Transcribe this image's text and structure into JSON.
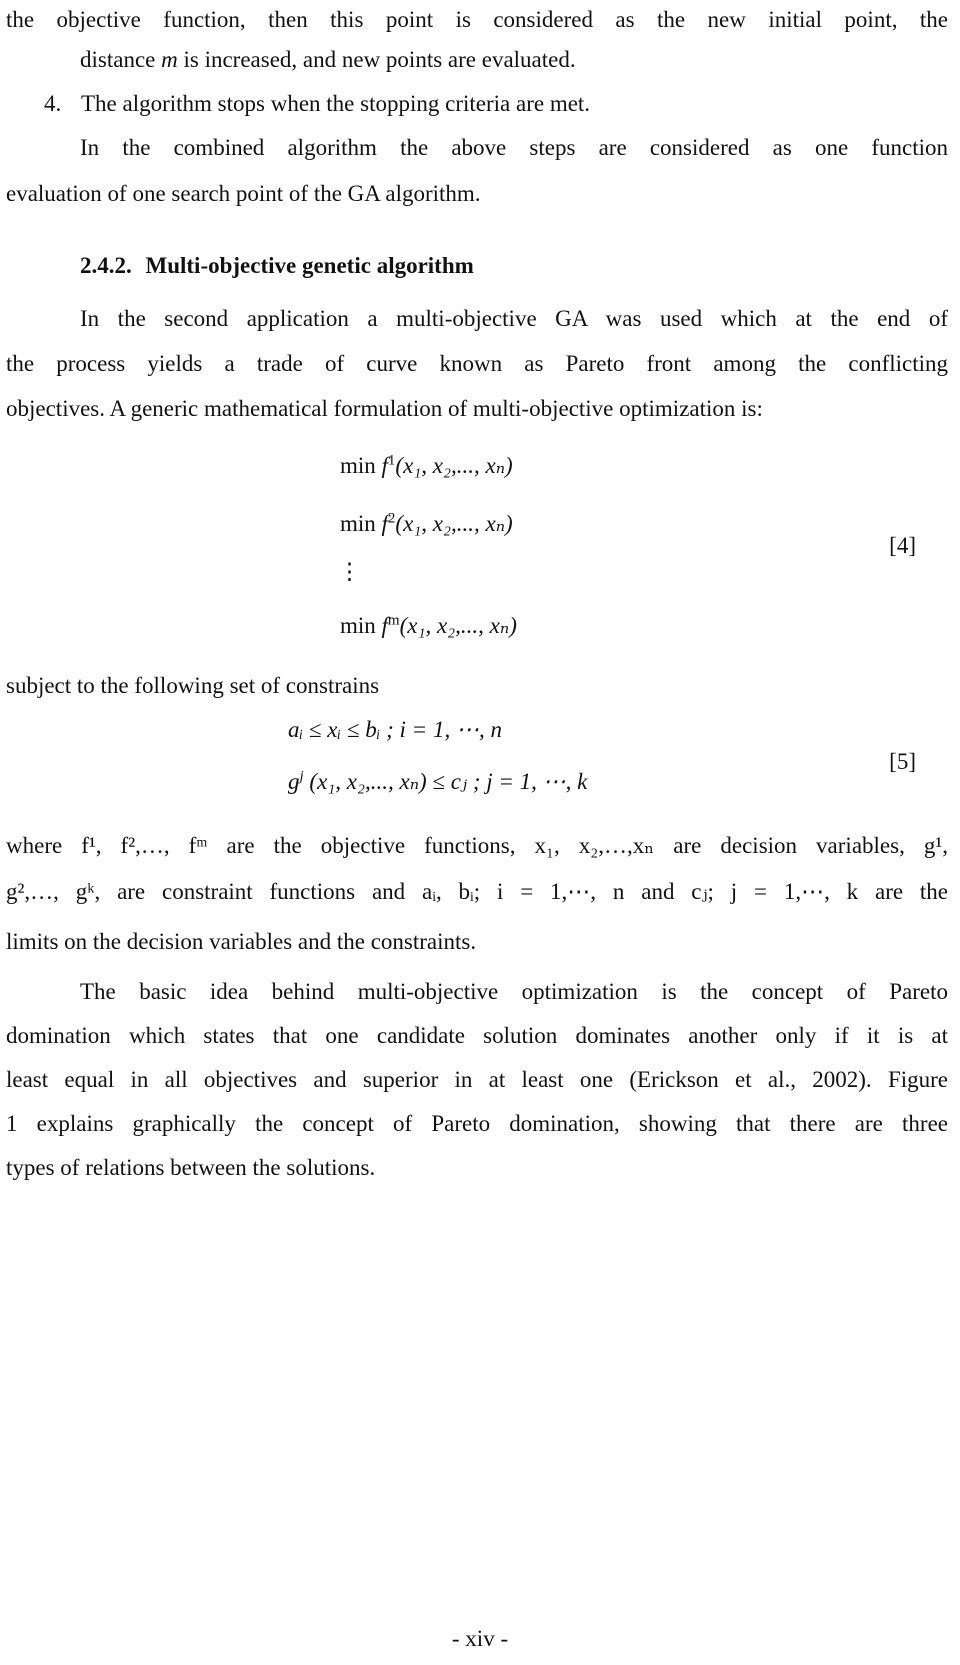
{
  "page": {
    "paragraphs_top": [
      "the objective function, then this point is considered as the new initial point, the",
      "distance",
      "m",
      "is increased, and new points are evaluated.",
      "4.",
      "The algorithm stops when the stopping criteria are met.",
      "In the combined algorithm the above steps are considered as one function",
      "evaluation of one search point of the GA algorithm."
    ],
    "section": {
      "number": "2.4.2.",
      "title": "Multi-objective genetic algorithm"
    },
    "intro": [
      "In the second application a multi-objective GA was used which at the end of",
      "the process yields a trade of curve known as Pareto front among the conflicting",
      "objectives. A generic mathematical formulation of multi-objective optimization is:"
    ],
    "equation4": {
      "lines": [
        {
          "op": "min",
          "fn": "f",
          "sup": "1",
          "args": "(x₁, x₂,..., xₙ)"
        },
        {
          "op": "min",
          "fn": "f",
          "sup": "2",
          "args": "(x₁, x₂,..., xₙ)"
        },
        {
          "op": "⋮",
          "fn": "",
          "sup": "",
          "args": ""
        },
        {
          "op": "min",
          "fn": "f",
          "sup": "m",
          "args": "(x₁, x₂,..., xₙ)"
        }
      ],
      "number": "[4]"
    },
    "constraints_intro": "subject to the following set of constrains",
    "equation5": {
      "line1": "aᵢ ≤ xᵢ ≤ bᵢ ;  i = 1, ⋯, n",
      "line2_fn": "g",
      "line2_sup": "j",
      "line2_rest": "(x₁, x₂,..., xₙ) ≤ cⱼ ;  j = 1, ⋯, k",
      "number": "[5]"
    },
    "where_lines": [
      "where f¹, f²,…, fᵐ are the objective functions, x₁, x₂,…,xₙ are decision variables, g¹,",
      "g²,…, gᵏ, are constraint functions and aᵢ, bᵢ; i = 1,⋯, n and cⱼ; j = 1,⋯, k are the",
      "limits on the decision variables and the constraints."
    ],
    "pareto_paragraph": [
      "The basic idea behind multi-objective optimization is the concept of Pareto",
      "domination which states that one candidate solution dominates another only if it is at",
      "least equal in all objectives and superior in at least one (Erickson et al., 2002).  Figure",
      "1 explains graphically the concept of Pareto domination, showing that there are three",
      "types of relations between the solutions."
    ],
    "page_number": "- xiv -"
  }
}
